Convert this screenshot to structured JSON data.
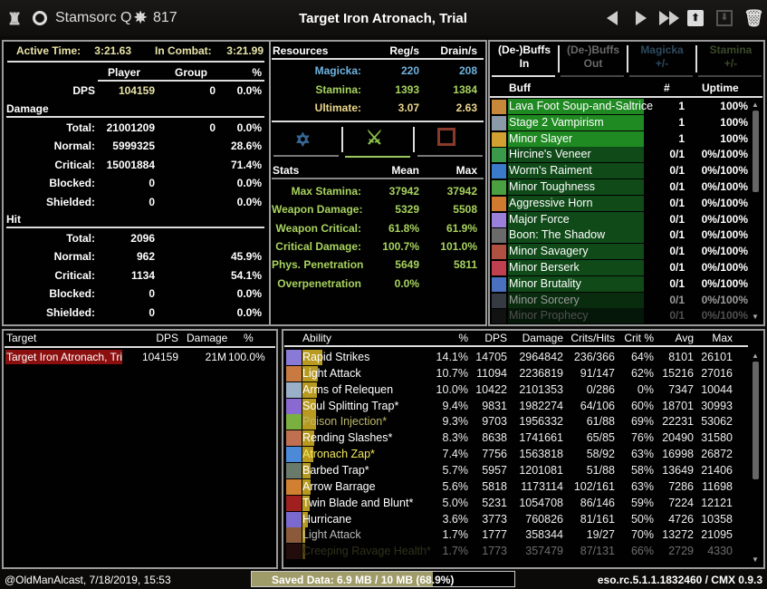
{
  "header": {
    "character": "Stamsorc Q",
    "cp": "817",
    "title": "Target Iron Atronach, Trial",
    "icons": [
      "trophy-icon",
      "clock-icon",
      "cp-star-icon",
      "prev-arrow-icon",
      "next-arrow-icon",
      "fast-forward-icon",
      "upload-icon",
      "download-icon",
      "trash-icon"
    ]
  },
  "combat": {
    "active_label": "Active Time:",
    "active_value": "3:21.63",
    "incombat_label": "In Combat:",
    "incombat_value": "3:21.99",
    "cols": [
      "Player",
      "Group",
      "%"
    ],
    "dps": {
      "label": "DPS",
      "player": "104159",
      "group": "0",
      "pct": "0.0%"
    },
    "damage_section": "Damage",
    "damage": [
      {
        "label": "Total:",
        "player": "21001209",
        "group": "0",
        "pct": "0.0%"
      },
      {
        "label": "Normal:",
        "player": "5999325",
        "group": "",
        "pct": "28.6%"
      },
      {
        "label": "Critical:",
        "player": "15001884",
        "group": "",
        "pct": "71.4%"
      },
      {
        "label": "Blocked:",
        "player": "0",
        "group": "",
        "pct": "0.0%"
      },
      {
        "label": "Shielded:",
        "player": "0",
        "group": "",
        "pct": "0.0%"
      }
    ],
    "hit_section": "Hit",
    "hit": [
      {
        "label": "Total:",
        "player": "2096",
        "group": "",
        "pct": ""
      },
      {
        "label": "Normal:",
        "player": "962",
        "group": "",
        "pct": "45.9%"
      },
      {
        "label": "Critical:",
        "player": "1134",
        "group": "",
        "pct": "54.1%"
      },
      {
        "label": "Blocked:",
        "player": "0",
        "group": "",
        "pct": "0.0%"
      },
      {
        "label": "Shielded:",
        "player": "0",
        "group": "",
        "pct": "0.0%"
      }
    ]
  },
  "resources": {
    "header": [
      "Resources",
      "Reg/s",
      "Drain/s"
    ],
    "rows": [
      {
        "label": "Magicka:",
        "reg": "220",
        "drain": "208",
        "color": "#6fb3e0"
      },
      {
        "label": "Stamina:",
        "reg": "1393",
        "drain": "1384",
        "color": "#a8d35e"
      },
      {
        "label": "Ultimate:",
        "reg": "3.07",
        "drain": "2.63",
        "color": "#ecd88c"
      }
    ],
    "tabs": [
      "magicka-icon",
      "stamina-icon",
      "health-icon"
    ],
    "active_tab": 1,
    "stats_header": [
      "Stats",
      "Mean",
      "Max"
    ],
    "stats": [
      {
        "label": "Max Stamina:",
        "mean": "37942",
        "max": "37942"
      },
      {
        "label": "Weapon Damage:",
        "mean": "5329",
        "max": "5508"
      },
      {
        "label": "Weapon Critical:",
        "mean": "61.8%",
        "max": "61.9%"
      },
      {
        "label": "Critical Damage:",
        "mean": "100.7%",
        "max": "101.0%"
      },
      {
        "label": "Phys. Penetration",
        "mean": "5649",
        "max": "5811"
      },
      {
        "label": "Overpenetration",
        "mean": "0.0%",
        "max": ""
      }
    ]
  },
  "buffs": {
    "tabs": [
      {
        "l1": "(De-)Buffs",
        "l2": "In",
        "active": true,
        "color": "#ffffff"
      },
      {
        "l1": "(De-)Buffs",
        "l2": "Out",
        "active": false,
        "color": "#6a6a6a"
      },
      {
        "l1": "Magicka",
        "l2": "+/-",
        "active": false,
        "color": "#2e4a5e"
      },
      {
        "l1": "Stamina",
        "l2": "+/-",
        "active": false,
        "color": "#3a4a2a"
      }
    ],
    "cols": [
      "Buff",
      "#",
      "Uptime"
    ],
    "rows": [
      {
        "name": "Lava Foot Soup-and-Saltrice",
        "count": "1",
        "uptime": "100%",
        "full": true,
        "icon": "#c8883a"
      },
      {
        "name": "Stage 2 Vampirism",
        "count": "1",
        "uptime": "100%",
        "full": true,
        "icon": "#8a9aa8"
      },
      {
        "name": "Minor Slayer",
        "count": "1",
        "uptime": "100%",
        "full": true,
        "icon": "#d0a030"
      },
      {
        "name": "Hircine's Veneer",
        "count": "0/1",
        "uptime": "0%/100%",
        "full": false,
        "icon": "#3a9a4a"
      },
      {
        "name": "Worm's Raiment",
        "count": "0/1",
        "uptime": "0%/100%",
        "full": false,
        "icon": "#3a7ac8"
      },
      {
        "name": "Minor Toughness",
        "count": "0/1",
        "uptime": "0%/100%",
        "full": false,
        "icon": "#4aa040"
      },
      {
        "name": "Aggressive Horn",
        "count": "0/1",
        "uptime": "0%/100%",
        "full": false,
        "icon": "#d07a30"
      },
      {
        "name": "Major Force",
        "count": "0/1",
        "uptime": "0%/100%",
        "full": false,
        "icon": "#9a80d8"
      },
      {
        "name": "Boon: The Shadow",
        "count": "0/1",
        "uptime": "0%/100%",
        "full": false,
        "icon": "#6a6a6a"
      },
      {
        "name": "Minor Savagery",
        "count": "0/1",
        "uptime": "0%/100%",
        "full": false,
        "icon": "#b05040"
      },
      {
        "name": "Minor Berserk",
        "count": "0/1",
        "uptime": "0%/100%",
        "full": false,
        "icon": "#c04050"
      },
      {
        "name": "Minor Brutality",
        "count": "0/1",
        "uptime": "0%/100%",
        "full": false,
        "icon": "#4a70c0"
      },
      {
        "name": "Minor Sorcery",
        "count": "0/1",
        "uptime": "0%/100%",
        "full": false,
        "icon": "#5a6070"
      },
      {
        "name": "Minor Prophecy",
        "count": "0/1",
        "uptime": "0%/100%",
        "full": false,
        "icon": "#3a3a3a"
      }
    ]
  },
  "targets": {
    "cols": [
      "Target",
      "DPS",
      "Damage",
      "%"
    ],
    "rows": [
      {
        "name": "Target Iron Atronach, Tri",
        "dps": "104159",
        "damage": "21M",
        "pct": "100.0%"
      }
    ],
    "highlight": "#8b0f0f"
  },
  "abilities": {
    "cols": [
      "Ability",
      "%",
      "DPS",
      "Damage",
      "Crits/Hits",
      "Crit %",
      "Avg",
      "Max"
    ],
    "rows": [
      {
        "name": "Rapid Strikes",
        "pct": "14.1%",
        "dps": "14705",
        "damage": "2964842",
        "crits": "236/366",
        "critpct": "64%",
        "avg": "8101",
        "max": "26101",
        "color": "#ffffff",
        "icon": "#8a7ad8"
      },
      {
        "name": "Light Attack",
        "pct": "10.7%",
        "dps": "11094",
        "damage": "2236819",
        "crits": "91/147",
        "critpct": "62%",
        "avg": "15216",
        "max": "27016",
        "color": "#ffffff",
        "icon": "#c87a40"
      },
      {
        "name": "Arms of Relequen",
        "pct": "10.0%",
        "dps": "10422",
        "damage": "2101353",
        "crits": "0/286",
        "critpct": "0%",
        "avg": "7347",
        "max": "10044",
        "color": "#ffffff",
        "icon": "#9ab0c8"
      },
      {
        "name": "Soul Splitting Trap*",
        "pct": "9.4%",
        "dps": "9831",
        "damage": "1982274",
        "crits": "64/106",
        "critpct": "60%",
        "avg": "18701",
        "max": "30993",
        "color": "#ffffff",
        "icon": "#8a6ad0"
      },
      {
        "name": "Poison Injection*",
        "pct": "9.3%",
        "dps": "9703",
        "damage": "1956332",
        "crits": "61/88",
        "critpct": "69%",
        "avg": "22231",
        "max": "53062",
        "color": "#bdb86a",
        "icon": "#7ab040"
      },
      {
        "name": "Rending Slashes*",
        "pct": "8.3%",
        "dps": "8638",
        "damage": "1741661",
        "crits": "65/85",
        "critpct": "76%",
        "avg": "20490",
        "max": "31580",
        "color": "#ffffff",
        "icon": "#c07050"
      },
      {
        "name": "Atronach Zap*",
        "pct": "7.4%",
        "dps": "7756",
        "damage": "1563818",
        "crits": "58/92",
        "critpct": "63%",
        "avg": "16998",
        "max": "26872",
        "color": "#f2e860",
        "icon": "#4a8ad8"
      },
      {
        "name": "Barbed Trap*",
        "pct": "5.7%",
        "dps": "5957",
        "damage": "1201081",
        "crits": "51/88",
        "critpct": "58%",
        "avg": "13649",
        "max": "21406",
        "color": "#ffffff",
        "icon": "#6a7a6a"
      },
      {
        "name": "Arrow Barrage",
        "pct": "5.6%",
        "dps": "5818",
        "damage": "1173114",
        "crits": "102/161",
        "critpct": "63%",
        "avg": "7286",
        "max": "11698",
        "color": "#ffffff",
        "icon": "#d08030"
      },
      {
        "name": "Twin Blade and Blunt*",
        "pct": "5.0%",
        "dps": "5231",
        "damage": "1054708",
        "crits": "86/146",
        "critpct": "59%",
        "avg": "7224",
        "max": "12121",
        "color": "#ffffff",
        "icon": "#a02020"
      },
      {
        "name": "Hurricane",
        "pct": "3.6%",
        "dps": "3773",
        "damage": "760826",
        "crits": "81/161",
        "critpct": "50%",
        "avg": "4726",
        "max": "10358",
        "color": "#ffffff",
        "icon": "#7a6ad0"
      },
      {
        "name": "Light Attack",
        "pct": "1.7%",
        "dps": "1777",
        "damage": "358344",
        "crits": "19/27",
        "critpct": "70%",
        "avg": "13272",
        "max": "21095",
        "color": "#bbbbbb",
        "icon": "#8a5a3a"
      },
      {
        "name": "Creeping Ravage Health*",
        "pct": "1.7%",
        "dps": "1773",
        "damage": "357479",
        "crits": "87/131",
        "critpct": "66%",
        "avg": "2729",
        "max": "4330",
        "color": "#6a6a3a",
        "icon": "#4a1a1a"
      }
    ]
  },
  "footer": {
    "account": "@OldManAlcast, 7/18/2019, 15:53",
    "saved": "Saved Data: 6.9 MB / 10 MB (68.9%)",
    "saved_fraction": 0.689,
    "version": "eso.rc.5.1.1.1832460 / CMX 0.9.3"
  }
}
